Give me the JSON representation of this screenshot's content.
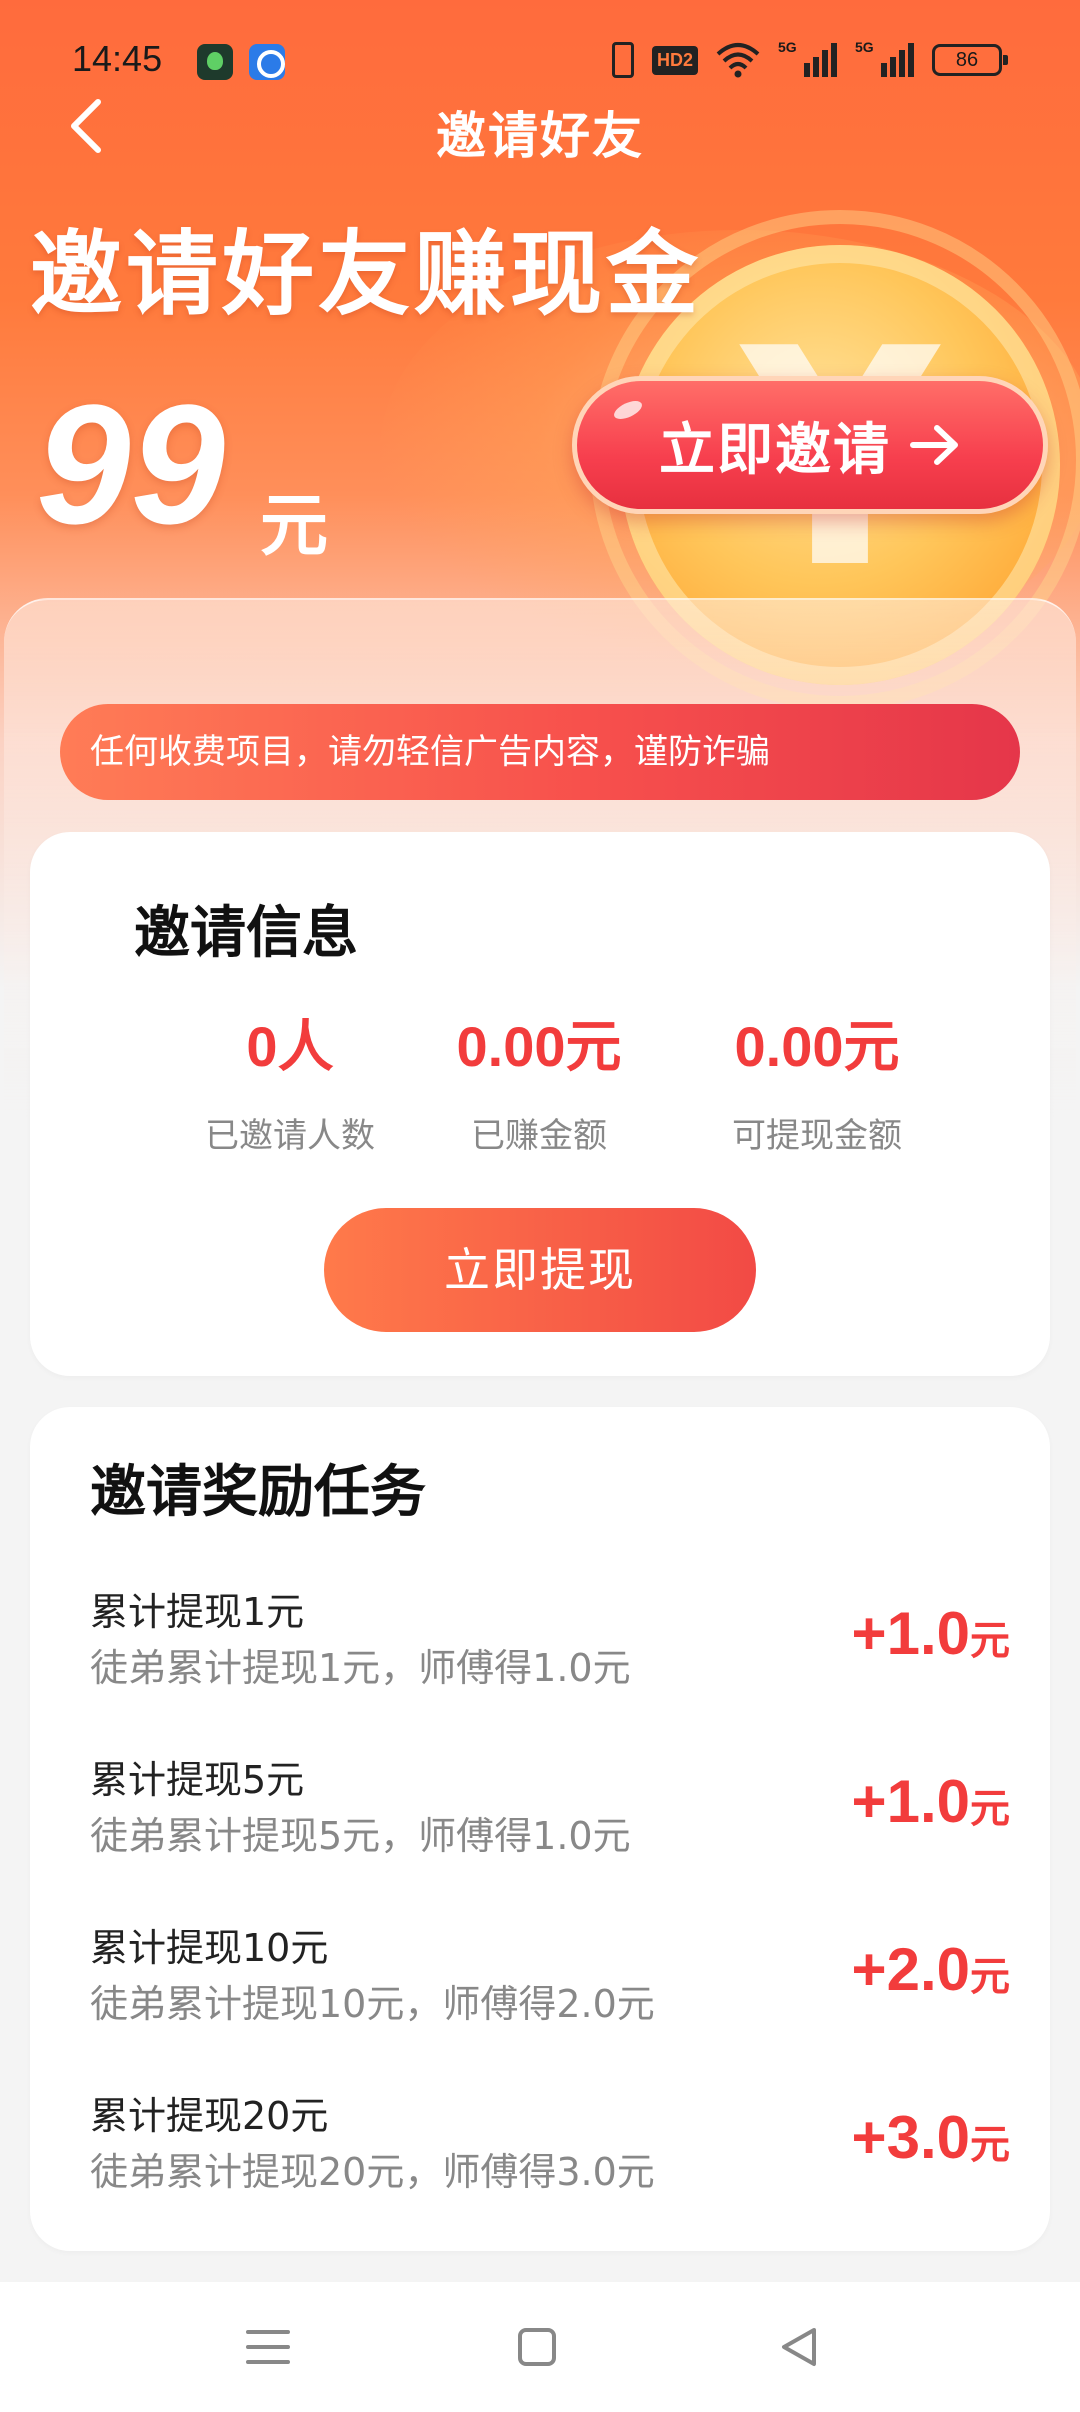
{
  "status_bar": {
    "time": "14:45",
    "battery": "86",
    "hd_label": "HD2",
    "network_1": "5G",
    "network_2": "5G"
  },
  "nav": {
    "title": "邀请好友"
  },
  "hero": {
    "headline": "邀请好友赚现金",
    "amount": "99",
    "unit": "元",
    "invite_button": "立即邀请",
    "coin_symbol": "¥"
  },
  "notice": {
    "text": "任何收费项目，请勿轻信广告内容，谨防诈骗"
  },
  "invite_info": {
    "title": "邀请信息",
    "stats": [
      {
        "value": "0人",
        "label": "已邀请人数"
      },
      {
        "value": "0.00元",
        "label": "已赚金额"
      },
      {
        "value": "0.00元",
        "label": "可提现金额"
      }
    ],
    "withdraw_button": "立即提现"
  },
  "tasks": {
    "title": "邀请奖励任务",
    "items": [
      {
        "name": "累计提现1元",
        "desc": "徒弟累计提现1元，师傅得1.0元",
        "reward": "+1.0",
        "unit": "元"
      },
      {
        "name": "累计提现5元",
        "desc": "徒弟累计提现5元，师傅得1.0元",
        "reward": "+1.0",
        "unit": "元"
      },
      {
        "name": "累计提现10元",
        "desc": "徒弟累计提现10元，师傅得2.0元",
        "reward": "+2.0",
        "unit": "元"
      },
      {
        "name": "累计提现20元",
        "desc": "徒弟累计提现20元，师傅得3.0元",
        "reward": "+3.0",
        "unit": "元"
      }
    ]
  },
  "colors": {
    "brand_orange": "#ff6b3d",
    "accent_red": "#f23c3c",
    "button_red": "#f73f4e"
  },
  "icons": [
    "back-arrow-icon",
    "arrow-right-icon",
    "menu-icon",
    "home-icon",
    "back-triangle-icon"
  ]
}
